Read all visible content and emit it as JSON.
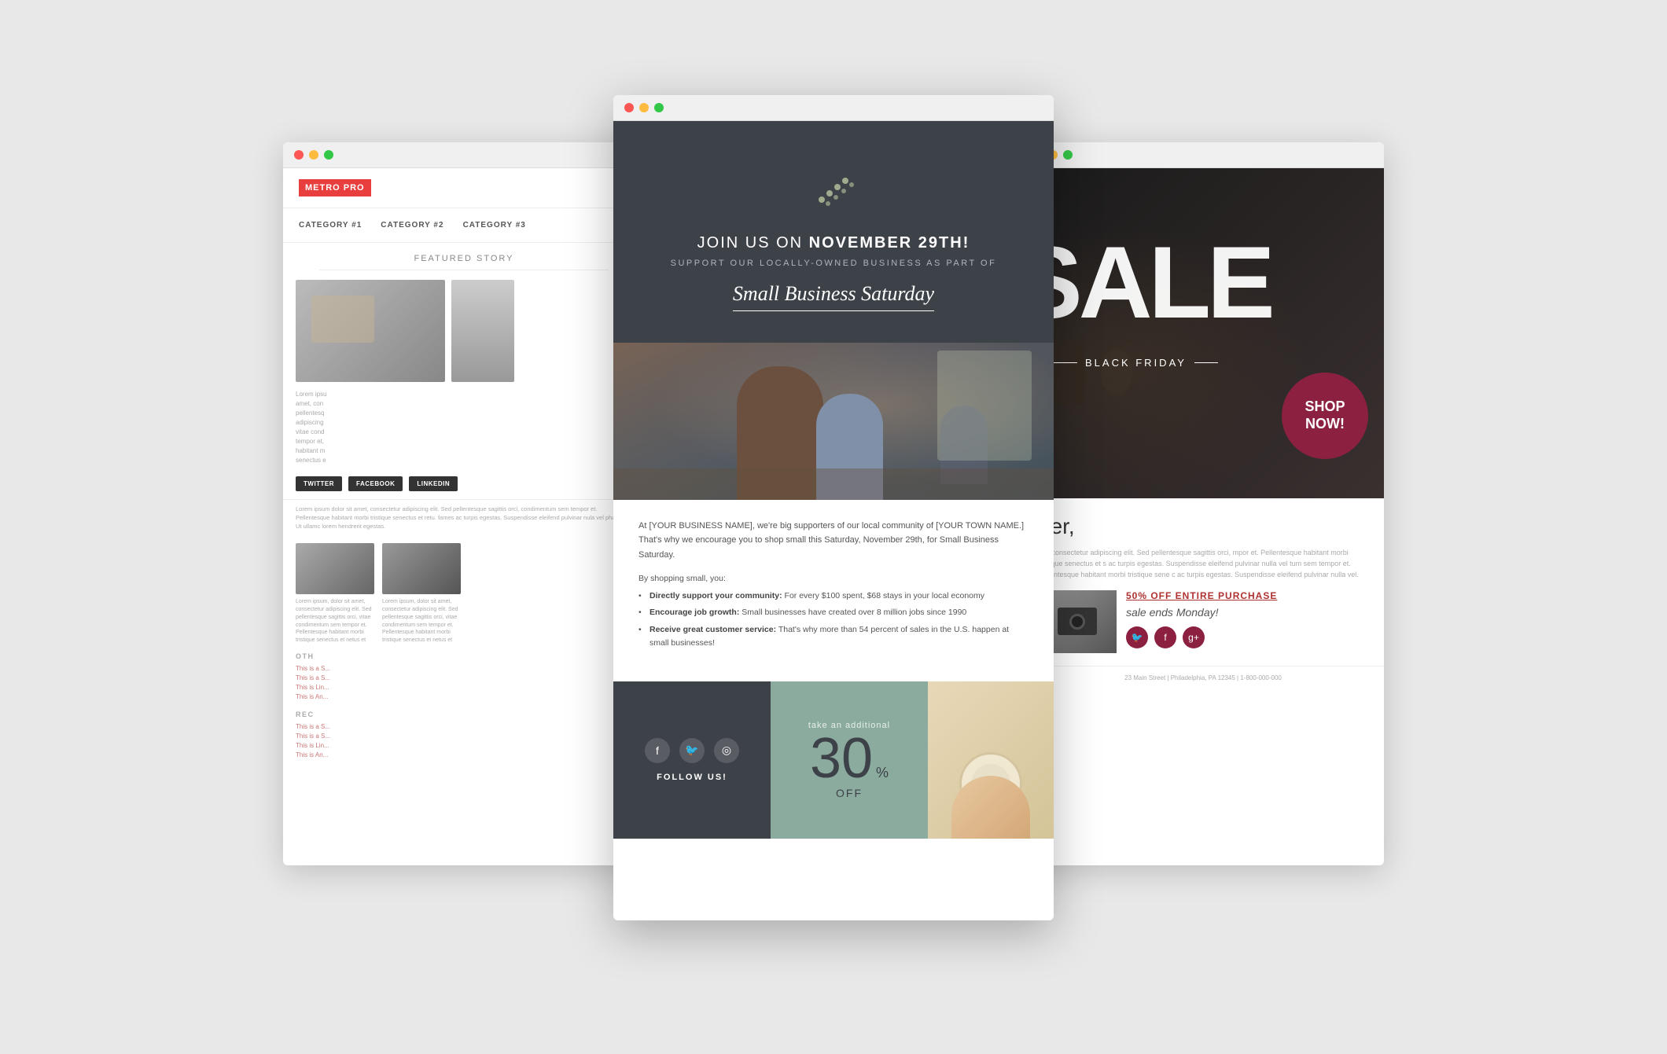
{
  "left_window": {
    "logo": "METRO PRO",
    "nav": {
      "items": [
        "CATEGORY #1",
        "CATEGORY #2",
        "CATEGORY #3"
      ]
    },
    "featured_label": "FEATURED STORY",
    "social_buttons": [
      "TWITTER",
      "FACEBOOK",
      "LINKEDIN"
    ],
    "body_text": "Lorem ipsum dolor sit amet, consectetur adipiscing elit. Sed pellentesque sagittis orci, condimentum sem tempor et. Pellentesque habitant morbi tristique senectus et retu. fames ac turpis egestas. Suspendisse eleifend pulvinar nula vel pharetra. Ut ullamc lorem hendrerit egestas.",
    "thumb_text_1": "Lorem ipsum, dolor sit amet, consectetur adipiscing elit. Sed pellentesque sagittis orci, vitae condimentum sem tempor et. Pellentesque habitant morbi tristique senectus et netus et",
    "thumb_text_2": "Lorem ipsum, dolor sit amet, consectetur adipiscing elit. Sed pellentesque sagittis orci, vitae condimentum sem tempor et. Pellentesque habitant morbi tristique senectus et netus et",
    "other_label": "OTH",
    "links": [
      "This is a S...",
      "This is a S...",
      "This is Lin...",
      "This is An..."
    ],
    "rec_label": "REC",
    "rec_links": [
      "This is a S...",
      "This is a S...",
      "This is Lin...",
      "This is An..."
    ]
  },
  "center_window": {
    "join_text_plain": "JOIN US ON ",
    "join_text_bold": "NOVEMBER 29th!",
    "support_text": "SUPPORT OUR LOCALLY-OWNED BUSINESS AS PART OF",
    "small_biz_title": "Small Business Saturday",
    "body_intro": "At [YOUR BUSINESS NAME], we're big supporters of our local community of [YOUR TOWN NAME.] That's why we encourage you to shop small this Saturday, November 29th, for Small Business Saturday.",
    "shopping_small_label": "By shopping small, you:",
    "bullets": [
      {
        "label": "Directly support your community:",
        "text": "For every $100 spent, $68 stays in your local economy"
      },
      {
        "label": "Encourage job growth:",
        "text": "Small businesses have created over 8 million jobs since 1990"
      },
      {
        "label": "Receive great customer service:",
        "text": "That's why more than 54 percent of sales in the U.S. happen at small businesses!"
      }
    ],
    "footer": {
      "follow_label": "FOLLOW US!",
      "take_additional": "take an additional",
      "discount_number": "30",
      "discount_off": "OFF"
    }
  },
  "right_window": {
    "sale_text": "SALE",
    "black_friday_text": "BLACK FRIDAY",
    "shop_now_line1": "SHOP",
    "shop_now_line2": "NOW!",
    "greeting": "ber,",
    "body_text": "eet, consectetur adipiscing elit. Sed pellentesque sagittis orci, mpor et. Pellentesque habitant morbi tristique senectus et s ac turpis egestas. Suspendisse eleifend pulvinar nulla vel tum sem tempor et. Pellentesque habitant morbi tristique sene c ac turpis egestas. Suspendisse eleifend pulvinar nulla vel.",
    "fifty_off": "50% OFF ENTIRE PURCHASE",
    "sale_ends": "sale ends Monday!",
    "footer_address": "23 Main Street | Philadelphia, PA 12345 | 1-800-000-000"
  }
}
